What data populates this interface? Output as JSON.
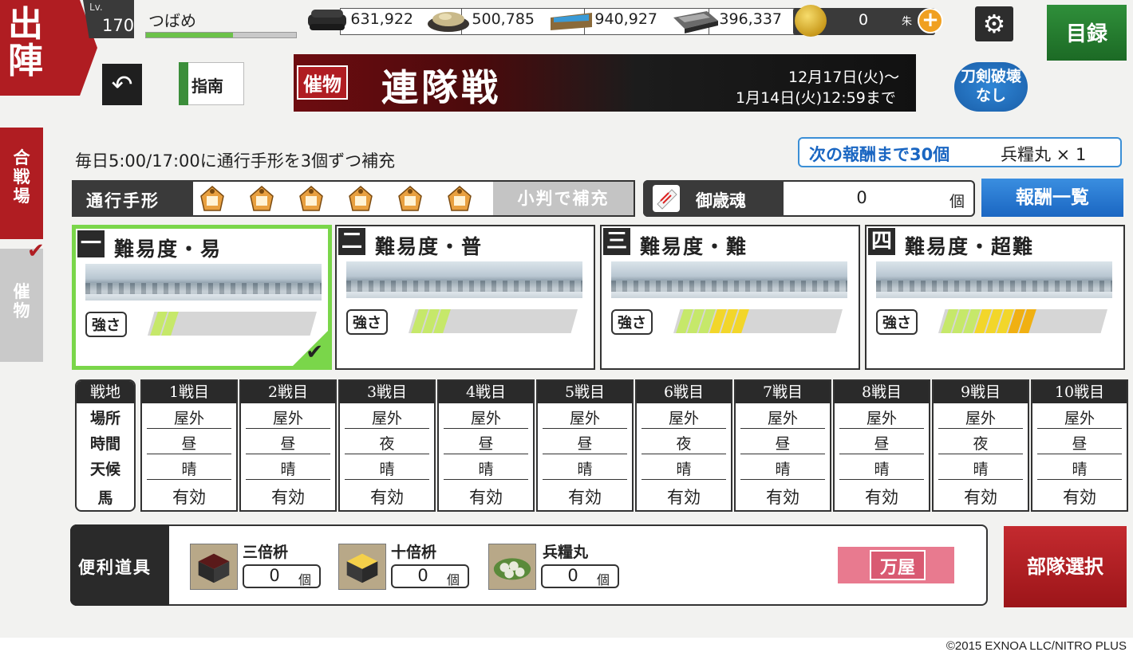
{
  "header": {
    "sortie_label": [
      "出",
      "陣"
    ],
    "lv_label": "Lv.",
    "level": "170",
    "player_name": "つばめ",
    "exp_progress": 0.58,
    "resources": [
      {
        "icon": "charcoal-icon",
        "value": "631,922"
      },
      {
        "icon": "steel-icon",
        "value": "500,785"
      },
      {
        "icon": "coolant-icon",
        "value": "940,927"
      },
      {
        "icon": "whetstone-icon",
        "value": "396,337"
      }
    ],
    "koban": {
      "icon": "koban-coin-icon",
      "value": "0",
      "unit": "朱"
    },
    "settings_icon": "gear-icon",
    "catalog_label": "目録",
    "back_icon": "back-arrow-icon",
    "guide_label": "指南"
  },
  "event": {
    "tag": "催物",
    "title": "連隊戦",
    "date_start": "12月17日(火)～",
    "date_end": "1月14日(火)12:59まで",
    "no_break_label": [
      "刀剣破壊",
      "なし"
    ]
  },
  "side_tabs": {
    "battle_field": "合戦場",
    "event": "催物"
  },
  "info": {
    "replenish_text": "毎日5:00/17:00に通行手形を3個ずつ補充",
    "next_reward_text": "次の報酬まで30個",
    "next_reward_item": "兵糧丸 × 1",
    "pass_label": "通行手形",
    "pass_count": 6,
    "refill_label": "小判で補充",
    "tama_label": "御歳魂",
    "tama_value": "0",
    "tama_unit": "個",
    "reward_list_label": "報酬一覧"
  },
  "difficulties": [
    {
      "num": "一",
      "title": "難易度・易",
      "strength_label": "強さ",
      "strength": 2,
      "selected": true
    },
    {
      "num": "二",
      "title": "難易度・普",
      "strength_label": "強さ",
      "strength": 3,
      "selected": false
    },
    {
      "num": "三",
      "title": "難易度・難",
      "strength_label": "強さ",
      "strength": 6,
      "selected": false
    },
    {
      "num": "四",
      "title": "難易度・超難",
      "strength_label": "強さ",
      "strength": 8,
      "selected": false
    }
  ],
  "colors": {
    "red": "#b01d22",
    "green": "#7ad64a",
    "blue": "#1a66c2",
    "meter_low": "#c6e86a",
    "meter_mid": "#f2d62a",
    "meter_high": "#f0b012"
  },
  "battle_table": {
    "head": "戦地",
    "row_labels": [
      "場所",
      "時間",
      "天候",
      "馬"
    ],
    "columns": [
      {
        "head": "1戦目",
        "place": "屋外",
        "time": "昼",
        "weather": "晴",
        "horse": "有効"
      },
      {
        "head": "2戦目",
        "place": "屋外",
        "time": "昼",
        "weather": "晴",
        "horse": "有効"
      },
      {
        "head": "3戦目",
        "place": "屋外",
        "time": "夜",
        "weather": "晴",
        "horse": "有効"
      },
      {
        "head": "4戦目",
        "place": "屋外",
        "time": "昼",
        "weather": "晴",
        "horse": "有効"
      },
      {
        "head": "5戦目",
        "place": "屋外",
        "time": "昼",
        "weather": "晴",
        "horse": "有効"
      },
      {
        "head": "6戦目",
        "place": "屋外",
        "time": "夜",
        "weather": "晴",
        "horse": "有効"
      },
      {
        "head": "7戦目",
        "place": "屋外",
        "time": "昼",
        "weather": "晴",
        "horse": "有効"
      },
      {
        "head": "8戦目",
        "place": "屋外",
        "time": "昼",
        "weather": "晴",
        "horse": "有効"
      },
      {
        "head": "9戦目",
        "place": "屋外",
        "time": "夜",
        "weather": "晴",
        "horse": "有効"
      },
      {
        "head": "10戦目",
        "place": "屋外",
        "time": "昼",
        "weather": "晴",
        "horse": "有効"
      }
    ]
  },
  "items": {
    "label": "便利道具",
    "list": [
      {
        "icon": "triple-masu-icon",
        "name": "三倍枡",
        "value": "0",
        "unit": "個"
      },
      {
        "icon": "tenfold-masu-icon",
        "name": "十倍枡",
        "value": "0",
        "unit": "個"
      },
      {
        "icon": "hyourougan-icon",
        "name": "兵糧丸",
        "value": "0",
        "unit": "個"
      }
    ],
    "shop_label": "万屋",
    "party_label": "部隊選択"
  },
  "footer": {
    "copyright": "©2015 EXNOA LLC/NITRO PLUS"
  }
}
